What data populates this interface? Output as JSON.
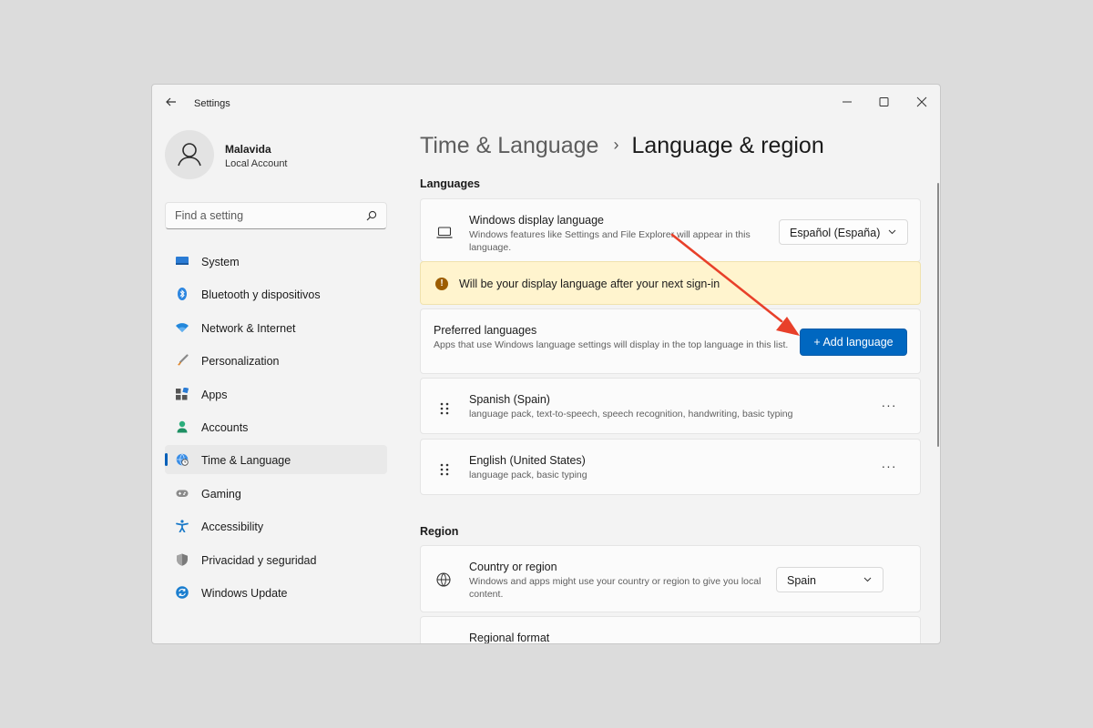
{
  "window": {
    "title": "Settings"
  },
  "profile": {
    "name": "Malavida",
    "account_type": "Local Account"
  },
  "search": {
    "placeholder": "Find a setting"
  },
  "nav": [
    {
      "label": "System",
      "icon": "monitor-icon",
      "active": false
    },
    {
      "label": "Bluetooth y dispositivos",
      "icon": "bluetooth-icon",
      "active": false
    },
    {
      "label": "Network & Internet",
      "icon": "wifi-icon",
      "active": false
    },
    {
      "label": "Personalization",
      "icon": "brush-icon",
      "active": false
    },
    {
      "label": "Apps",
      "icon": "apps-icon",
      "active": false
    },
    {
      "label": "Accounts",
      "icon": "person-icon",
      "active": false
    },
    {
      "label": "Time & Language",
      "icon": "globe-clock-icon",
      "active": true
    },
    {
      "label": "Gaming",
      "icon": "gamepad-icon",
      "active": false
    },
    {
      "label": "Accessibility",
      "icon": "accessibility-icon",
      "active": false
    },
    {
      "label": "Privacidad y seguridad",
      "icon": "shield-icon",
      "active": false
    },
    {
      "label": "Windows Update",
      "icon": "update-icon",
      "active": false
    }
  ],
  "breadcrumb": {
    "parent": "Time & Language",
    "separator": "›",
    "current": "Language & region"
  },
  "languages": {
    "section_label": "Languages",
    "display_language": {
      "title": "Windows display language",
      "description": "Windows features like Settings and File Explorer will appear in this language.",
      "selected": "Español (España)"
    },
    "banner": {
      "icon": "!",
      "text": "Will be your display language after your next sign-in"
    },
    "preferred": {
      "title": "Preferred languages",
      "description": "Apps that use Windows language settings will display in the top language in this list.",
      "add_button": "+ Add language"
    },
    "list": [
      {
        "name": "Spanish (Spain)",
        "features": "language pack, text-to-speech, speech recognition, handwriting, basic typing",
        "more": "···"
      },
      {
        "name": "English (United States)",
        "features": "language pack, basic typing",
        "more": "···"
      }
    ]
  },
  "region": {
    "section_label": "Region",
    "country": {
      "title": "Country or region",
      "description": "Windows and apps might use your country or region to give you local content.",
      "selected": "Spain"
    },
    "format": {
      "title": "Regional format"
    }
  },
  "colors": {
    "accent": "#0067c0",
    "banner_bg": "#fff4ce",
    "annotation_arrow": "#e8402a"
  }
}
